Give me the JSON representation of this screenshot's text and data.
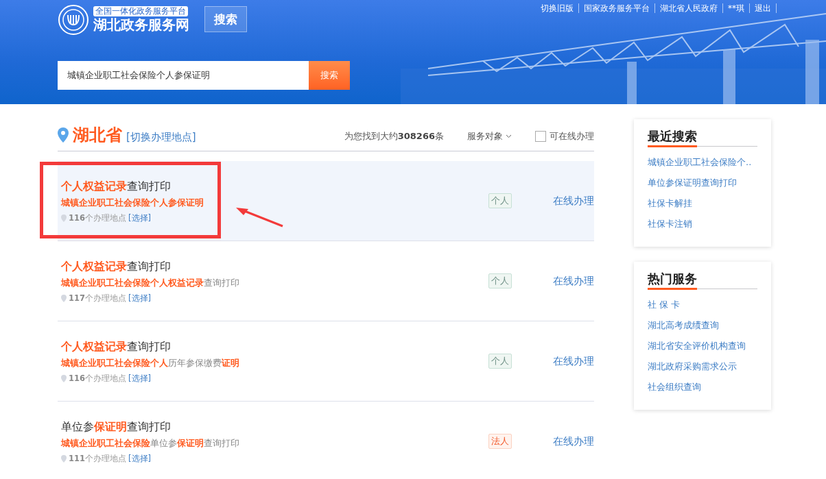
{
  "header": {
    "logo_subtitle": "全国一体化政务服务平台",
    "logo_title": "湖北政务服务网",
    "top_search_button": "搜索",
    "top_links": [
      "切换旧版",
      "国家政务服务平台",
      "湖北省人民政府",
      "**琪",
      "退出"
    ],
    "search": {
      "value": "城镇企业职工社会保险个人参保证明",
      "button": "搜索"
    }
  },
  "filter_bar": {
    "province": "湖北省",
    "switch_location": "[切换办理地点]",
    "result_count": "为您找到大约**308266**条",
    "service_target": "服务对象",
    "online_only": {
      "label": "可在线办理",
      "checked": false
    }
  },
  "results": [
    {
      "title": "**个人权益记录**查询打印",
      "subtitle": "**城镇企业职工社会保险个人参保证明**",
      "locations": "**116**个办理地点",
      "choose": "[选择]",
      "tag": "个人",
      "kind": "personal",
      "action": "在线办理",
      "highlighted": true
    },
    {
      "title": "**个人权益记录**查询打印",
      "subtitle": "**城镇企业职工社会保险个人权益记录**查询打印",
      "locations": "**117**个办理地点",
      "choose": "[选择]",
      "tag": "个人",
      "kind": "personal",
      "action": "在线办理",
      "highlighted": false
    },
    {
      "title": "**个人权益记录**查询打印",
      "subtitle": "**城镇企业职工社会保险个人**历年参保缴费**证明**",
      "locations": "**116**个办理地点",
      "choose": "[选择]",
      "tag": "个人",
      "kind": "personal",
      "action": "在线办理",
      "highlighted": false
    },
    {
      "title": "单位参**保证明**查询打印",
      "subtitle": "**城镇企业职工社会保险**单位参**保证明**查询打印",
      "locations": "**111**个办理地点",
      "choose": "[选择]",
      "tag": "法人",
      "kind": "legal",
      "action": "在线办理",
      "highlighted": false
    }
  ],
  "sidebar": [
    {
      "title": "最近搜索",
      "items": [
        "城镇企业职工社会保险个..",
        "单位参保证明查询打印",
        "社保卡解挂",
        "社保卡注销"
      ]
    },
    {
      "title": "热门服务",
      "items": [
        "社 保 卡",
        "湖北高考成绩查询",
        "湖北省安全评价机构查询",
        "湖北政府采购需求公示",
        "社会组织查询"
      ]
    }
  ]
}
